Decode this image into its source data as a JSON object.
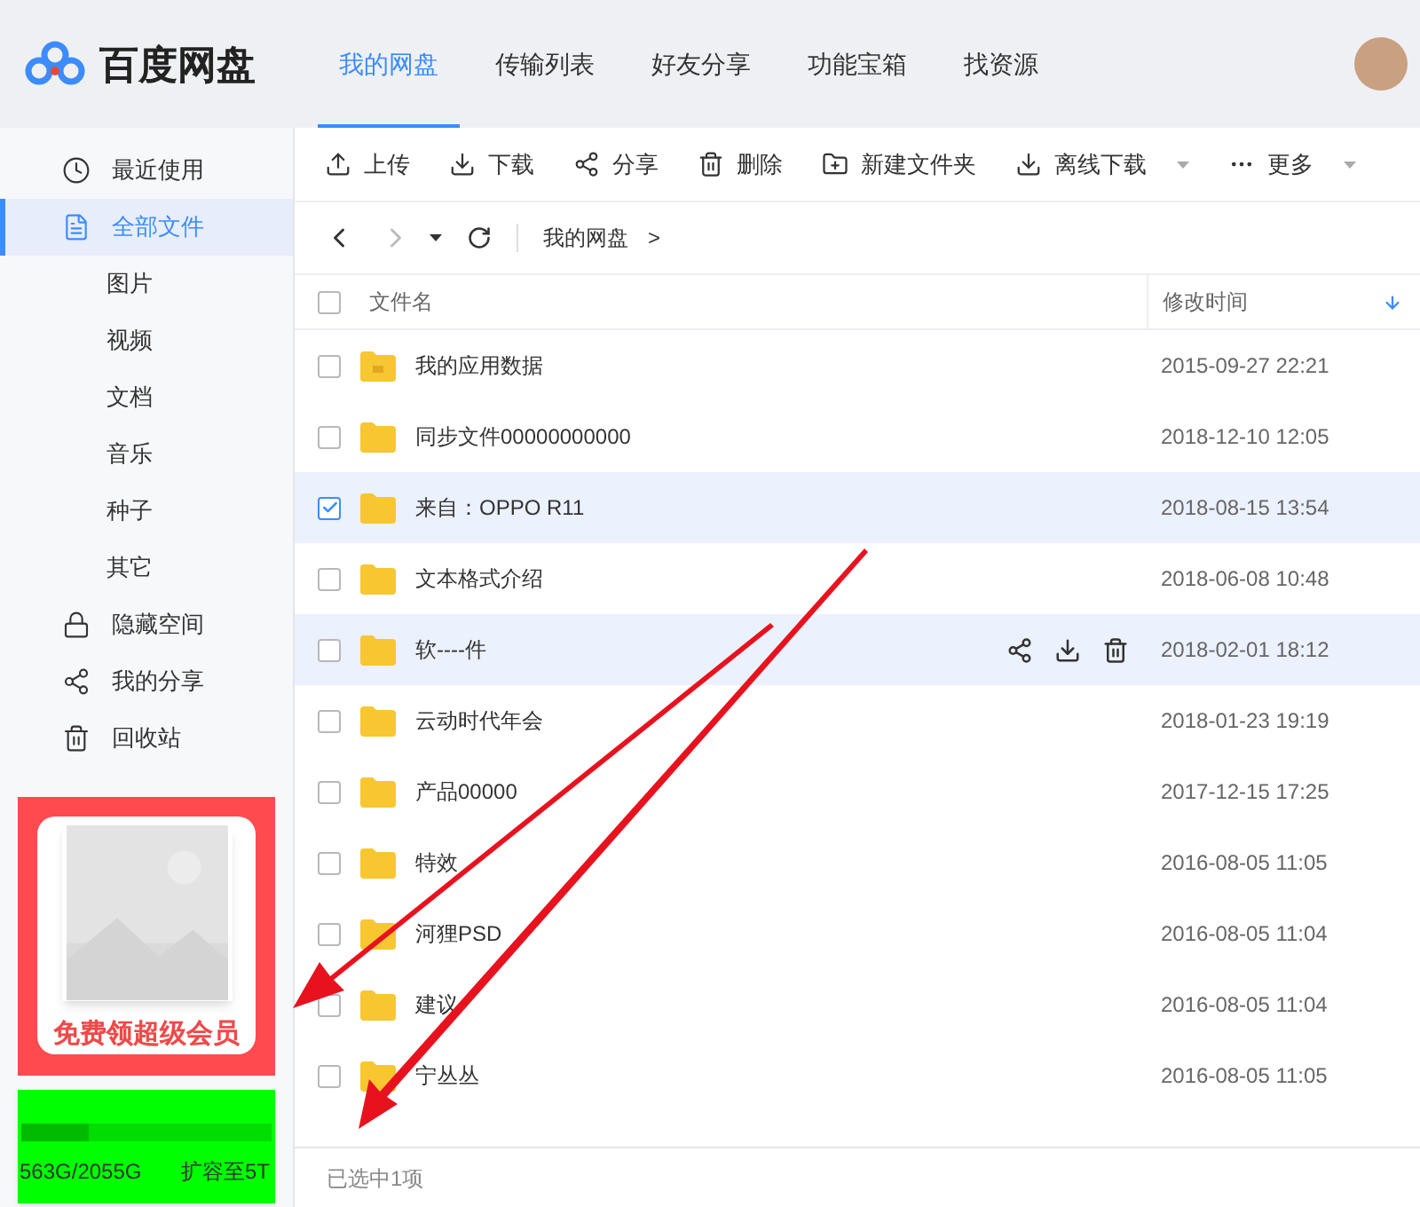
{
  "header": {
    "logo_text": "百度网盘",
    "tabs": [
      {
        "label": "我的网盘",
        "selected": true
      },
      {
        "label": "传输列表",
        "selected": false
      },
      {
        "label": "好友分享",
        "selected": false
      },
      {
        "label": "功能宝箱",
        "selected": false
      },
      {
        "label": "找资源",
        "selected": false
      }
    ]
  },
  "sidebar": {
    "items": [
      {
        "label": "最近使用",
        "kind": "top",
        "selected": false
      },
      {
        "label": "全部文件",
        "kind": "top",
        "selected": true
      },
      {
        "label": "图片",
        "kind": "sub",
        "selected": false
      },
      {
        "label": "视频",
        "kind": "sub",
        "selected": false
      },
      {
        "label": "文档",
        "kind": "sub",
        "selected": false
      },
      {
        "label": "音乐",
        "kind": "sub",
        "selected": false
      },
      {
        "label": "种子",
        "kind": "sub",
        "selected": false
      },
      {
        "label": "其它",
        "kind": "sub",
        "selected": false
      },
      {
        "label": "隐藏空间",
        "kind": "top",
        "selected": false
      },
      {
        "label": "我的分享",
        "kind": "top",
        "selected": false
      },
      {
        "label": "回收站",
        "kind": "top",
        "selected": false
      }
    ],
    "promo": {
      "text": "免费领超级会员"
    },
    "storage": {
      "level": 0.27,
      "usage": "563G/2055G",
      "upgrade": "扩容至5T"
    }
  },
  "toolbar": [
    {
      "label": "上传",
      "dropdown": false
    },
    {
      "label": "下载",
      "dropdown": false
    },
    {
      "label": "分享",
      "dropdown": false
    },
    {
      "label": "删除",
      "dropdown": false
    },
    {
      "label": "新建文件夹",
      "dropdown": false
    },
    {
      "label": "离线下载",
      "dropdown": true
    },
    {
      "label": "更多",
      "dropdown": true
    }
  ],
  "breadcrumb": [
    "我的网盘",
    ">"
  ],
  "table": {
    "columns": [
      "文件名",
      "修改时间"
    ],
    "all_checked": false,
    "rows": [
      {
        "name": "我的应用数据",
        "time": "2015-09-27 22:21",
        "checked": false,
        "hovered": false,
        "kind": "app"
      },
      {
        "name": "同步文件00000000000",
        "time": "2018-12-10 12:05",
        "checked": false,
        "hovered": false,
        "kind": "folder"
      },
      {
        "name": "来自：OPPO R11",
        "time": "2018-08-15 13:54",
        "checked": true,
        "hovered": false,
        "kind": "folder"
      },
      {
        "name": "文本格式介绍",
        "time": "2018-06-08 10:48",
        "checked": false,
        "hovered": false,
        "kind": "folder"
      },
      {
        "name": "软----件",
        "time": "2018-02-01 18:12",
        "checked": false,
        "hovered": true,
        "kind": "folder"
      },
      {
        "name": "云动时代年会",
        "time": "2018-01-23 19:19",
        "checked": false,
        "hovered": false,
        "kind": "folder"
      },
      {
        "name": "产品00000",
        "time": "2017-12-15 17:25",
        "checked": false,
        "hovered": false,
        "kind": "folder"
      },
      {
        "name": "特效",
        "time": "2016-08-05 11:05",
        "checked": false,
        "hovered": false,
        "kind": "folder"
      },
      {
        "name": "河狸PSD",
        "time": "2016-08-05 11:04",
        "checked": false,
        "hovered": false,
        "kind": "folder"
      },
      {
        "name": "建议",
        "time": "2016-08-05 11:04",
        "checked": false,
        "hovered": false,
        "kind": "folder"
      },
      {
        "name": "宁丛丛",
        "time": "2016-08-05 11:05",
        "checked": false,
        "hovered": false,
        "kind": "folder"
      }
    ]
  },
  "status_bar": "已选中1项"
}
